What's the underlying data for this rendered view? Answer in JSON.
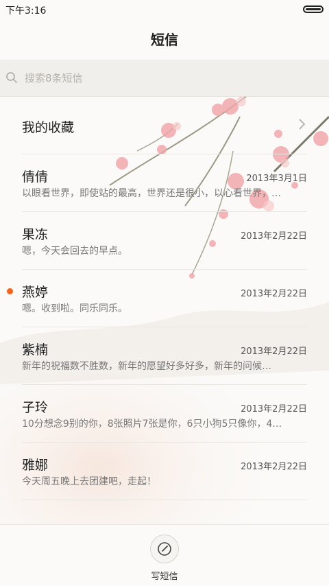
{
  "status_bar": {
    "time": "下午3:16"
  },
  "header": {
    "title": "短信"
  },
  "search": {
    "placeholder": "搜索8条短信"
  },
  "favorites": {
    "label": "我的收藏"
  },
  "messages": [
    {
      "name": "倩倩",
      "date": "2013年3月1日",
      "preview": "以眼看世界，即使站的最高，世界还是很小，以心看世界，…",
      "unread": false
    },
    {
      "name": "果冻",
      "date": "2013年2月22日",
      "preview": "嗯，今天会回去的早点。",
      "unread": false
    },
    {
      "name": "燕婷",
      "date": "2013年2月22日",
      "preview": "嗯。收到啦。同乐同乐。",
      "unread": true
    },
    {
      "name": "紫楠",
      "date": "2013年2月22日",
      "preview": "新年的祝福数不胜数，新年的愿望好多好多，新年的问候…",
      "unread": false
    },
    {
      "name": "子玲",
      "date": "2013年2月22日",
      "preview": "10分想念9别的你，8张照片7张是你，6只小狗5只像你，4…",
      "unread": false
    },
    {
      "name": "雅娜",
      "date": "2013年2月22日",
      "preview": "今天周五晚上去团建吧，走起！",
      "unread": false
    }
  ],
  "bottom": {
    "compose_label": "写短信"
  },
  "colors": {
    "unread_dot": "#f3641e",
    "search_bg": "#f1efeb",
    "blossom": "#f0a3a8"
  }
}
